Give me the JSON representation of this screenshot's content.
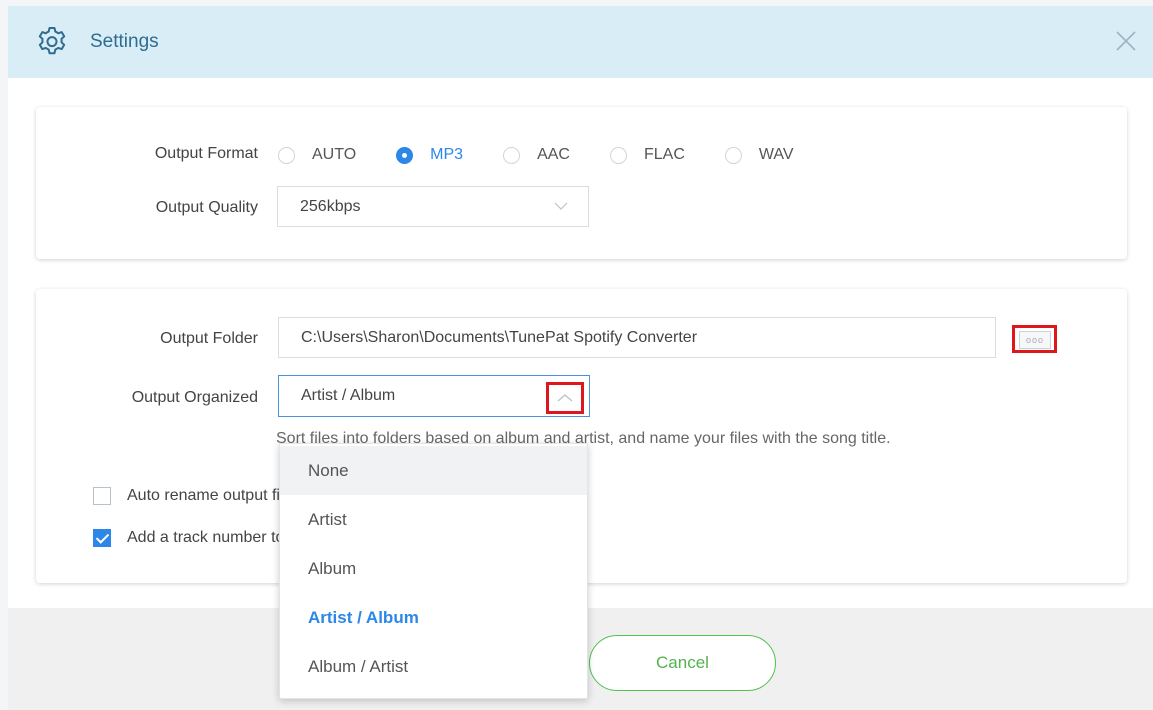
{
  "window": {
    "title": "Settings",
    "icon": "gear-icon",
    "close_icon": "close-icon"
  },
  "colors": {
    "accent": "#2c87e8",
    "header_bg": "#d9edf7",
    "highlight_box": "#e0161d",
    "cancel_green": "#52b34f"
  },
  "output_format": {
    "label": "Output Format",
    "options": [
      {
        "label": "AUTO",
        "checked": false
      },
      {
        "label": "MP3",
        "checked": true
      },
      {
        "label": "AAC",
        "checked": false
      },
      {
        "label": "FLAC",
        "checked": false
      },
      {
        "label": "WAV",
        "checked": false
      }
    ]
  },
  "output_quality": {
    "label": "Output Quality",
    "value": "256kbps"
  },
  "output_folder": {
    "label": "Output Folder",
    "value": "C:\\Users\\Sharon\\Documents\\TunePat Spotify Converter",
    "browse_label": "ooo"
  },
  "output_organized": {
    "label": "Output Organized",
    "value": "Artist / Album",
    "hint": "Sort files into folders based on album and artist, and name your files with the song title.",
    "options": [
      "None",
      "Artist",
      "Album",
      "Artist / Album",
      "Album / Artist"
    ],
    "selected": "Artist / Album",
    "hovered": "None"
  },
  "checkboxes": {
    "auto_rename": {
      "label": "Auto rename output files",
      "checked": false
    },
    "track_number": {
      "label": "Add a track number to the file name",
      "checked": true
    }
  },
  "footer": {
    "cancel_label": "Cancel"
  }
}
